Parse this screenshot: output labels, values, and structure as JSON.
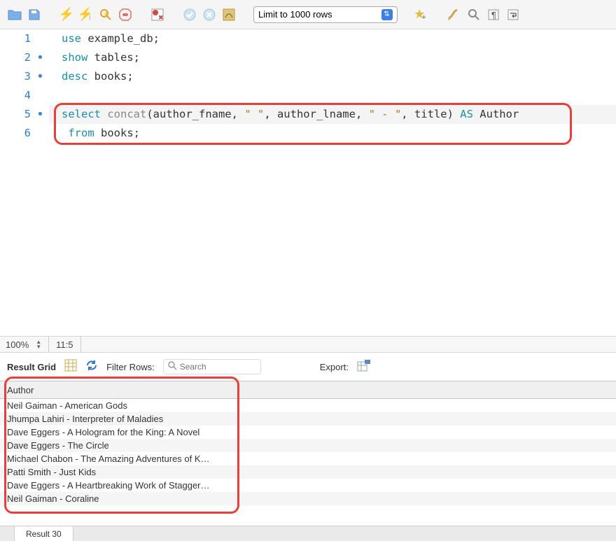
{
  "toolbar": {
    "limit_label": "Limit to 1000 rows"
  },
  "editor": {
    "lines": [
      {
        "n": "1",
        "dot": false
      },
      {
        "n": "2",
        "dot": true
      },
      {
        "n": "3",
        "dot": true
      },
      {
        "n": "4",
        "dot": false
      },
      {
        "n": "5",
        "dot": true
      },
      {
        "n": "6",
        "dot": false
      }
    ],
    "code": {
      "l1_kw": "use",
      "l1_rest": " example_db;",
      "l2_kw": "show",
      "l2_rest": " tables;",
      "l3_kw": "desc",
      "l3_rest": " books;",
      "l5_select": "select ",
      "l5_concat": "concat",
      "l5_open": "(author_fname, ",
      "l5_str1": "\" \"",
      "l5_mid1": ", author_lname, ",
      "l5_str2": "\" - \"",
      "l5_mid2": ", title) ",
      "l5_as": "AS",
      "l5_end": " Author",
      "l6_from": " from",
      "l6_rest": " books;"
    }
  },
  "status": {
    "zoom": "100%",
    "cursor": "11:5"
  },
  "resultsbar": {
    "title": "Result Grid",
    "filter_label": "Filter Rows:",
    "search_placeholder": "Search",
    "export_label": "Export:"
  },
  "grid": {
    "header": "Author",
    "rows": [
      "Neil Gaiman - American Gods",
      "Jhumpa Lahiri - Interpreter of Maladies",
      "Dave Eggers - A Hologram for the King: A Novel",
      "Dave Eggers - The Circle",
      "Michael Chabon - The Amazing Adventures of K…",
      "Patti Smith - Just Kids",
      "Dave Eggers - A Heartbreaking Work of Stagger…",
      "Neil Gaiman - Coraline"
    ]
  },
  "footer": {
    "tab": "Result 30"
  }
}
